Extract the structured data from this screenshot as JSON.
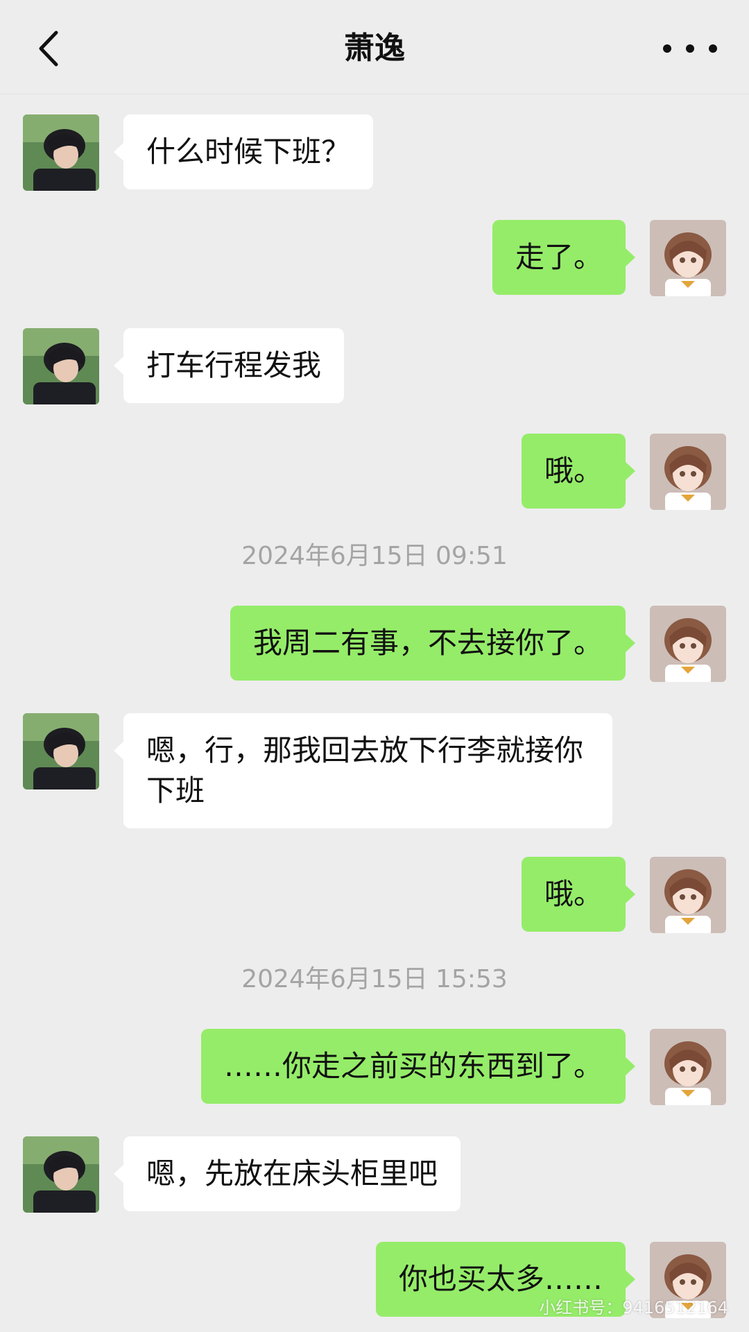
{
  "header": {
    "title": "萧逸",
    "back_icon": "chevron-left-icon",
    "more_icon": "more-dots-icon"
  },
  "colors": {
    "background": "#ededed",
    "self_bubble": "#95ec69",
    "other_bubble": "#ffffff",
    "timestamp_text": "#a4a4a4"
  },
  "messages": [
    {
      "side": "left",
      "text": "什么时候下班？"
    },
    {
      "side": "right",
      "text": "走了。"
    },
    {
      "side": "left",
      "text": "打车行程发我"
    },
    {
      "side": "right",
      "text": "哦。"
    },
    {
      "side": "right",
      "text": "我周二有事，不去接你了。"
    },
    {
      "side": "left",
      "text": "嗯，行，那我回去放下行李就接你下班"
    },
    {
      "side": "right",
      "text": "哦。"
    },
    {
      "side": "right",
      "text": "……你走之前买的东西到了。"
    },
    {
      "side": "left",
      "text": "嗯，先放在床头柜里吧"
    },
    {
      "side": "right",
      "text": "你也买太多……"
    }
  ],
  "timestamps": [
    "2024年6月15日 09:51",
    "2024年6月15日 15:53"
  ],
  "watermark": "小红书号：9416512164"
}
